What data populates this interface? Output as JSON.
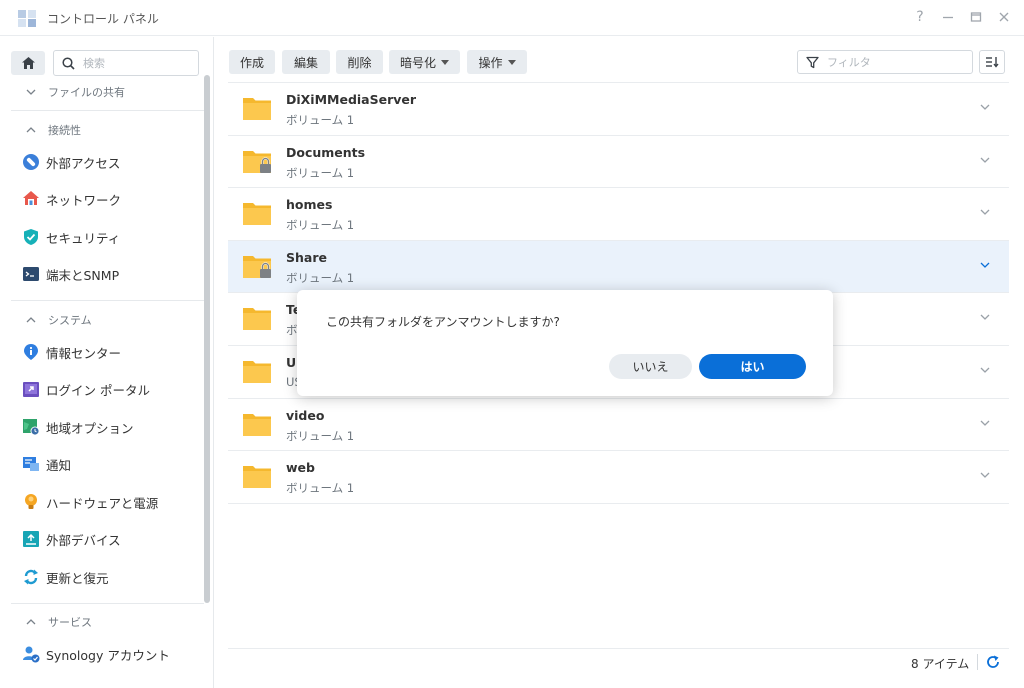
{
  "window": {
    "title": "コントロール パネル",
    "help_label": "?"
  },
  "sidebar": {
    "search_placeholder": "検索",
    "sections": [
      {
        "label": "ファイルの共有",
        "collapsed": true
      },
      {
        "label": "接続性",
        "collapsed": false
      },
      {
        "label": "システム",
        "collapsed": false
      },
      {
        "label": "サービス",
        "collapsed": false
      }
    ],
    "items": [
      {
        "label": "外部アクセス",
        "icon": "external-access-icon"
      },
      {
        "label": "ネットワーク",
        "icon": "network-icon"
      },
      {
        "label": "セキュリティ",
        "icon": "security-shield-icon"
      },
      {
        "label": "端末とSNMP",
        "icon": "terminal-icon"
      },
      {
        "label": "情報センター",
        "icon": "info-center-icon"
      },
      {
        "label": "ログイン ポータル",
        "icon": "login-portal-icon"
      },
      {
        "label": "地域オプション",
        "icon": "regional-options-icon"
      },
      {
        "label": "通知",
        "icon": "notification-icon"
      },
      {
        "label": "ハードウェアと電源",
        "icon": "hardware-power-icon"
      },
      {
        "label": "外部デバイス",
        "icon": "external-devices-icon"
      },
      {
        "label": "更新と復元",
        "icon": "update-restore-icon"
      },
      {
        "label": "Synology アカウント",
        "icon": "synology-account-icon"
      }
    ]
  },
  "toolbar": {
    "create": "作成",
    "edit": "編集",
    "delete": "削除",
    "encryption": "暗号化",
    "action": "操作",
    "filter_placeholder": "フィルタ"
  },
  "folders": [
    {
      "name": "DiXiMMediaServer",
      "volume": "ボリューム 1",
      "locked": false,
      "selected": false
    },
    {
      "name": "Documents",
      "volume": "ボリューム 1",
      "locked": true,
      "selected": false
    },
    {
      "name": "homes",
      "volume": "ボリューム 1",
      "locked": false,
      "selected": false
    },
    {
      "name": "Share",
      "volume": "ボリューム 1",
      "locked": true,
      "selected": true
    },
    {
      "name": "Te",
      "volume": "ボ",
      "locked": false,
      "selected": false
    },
    {
      "name": "US",
      "volume": "US",
      "locked": false,
      "selected": false
    },
    {
      "name": "video",
      "volume": "ボリューム 1",
      "locked": false,
      "selected": false
    },
    {
      "name": "web",
      "volume": "ボリューム 1",
      "locked": false,
      "selected": false
    }
  ],
  "footer": {
    "item_count": "8 アイテム"
  },
  "dialog": {
    "message": "この共有フォルダをアンマウントしますか?",
    "no_label": "いいえ",
    "yes_label": "はい"
  },
  "colors": {
    "accent": "#0a6fd8",
    "folder": "#fcc84e",
    "selected_row": "#eaf2fb"
  }
}
